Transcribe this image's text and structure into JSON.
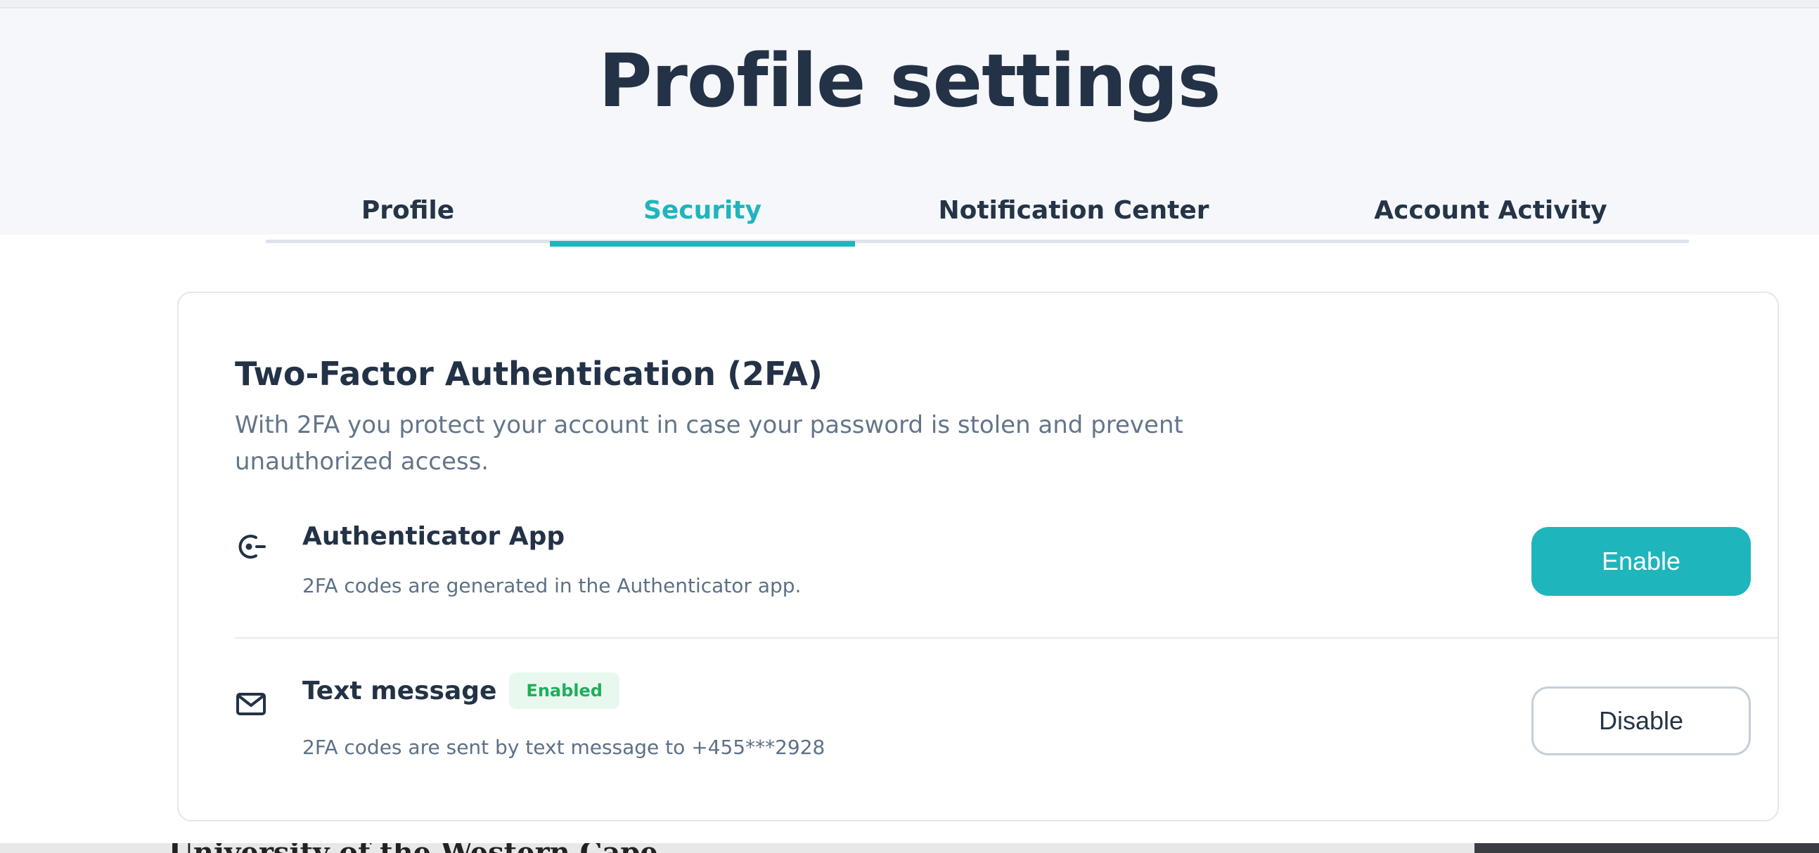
{
  "page": {
    "title": "Profile settings"
  },
  "tabs": [
    {
      "label": "Profile"
    },
    {
      "label": "Security"
    },
    {
      "label": "Notification Center"
    },
    {
      "label": "Account Activity"
    }
  ],
  "active_tab": "Security",
  "two_factor": {
    "title": "Two-Factor Authentication (2FA)",
    "description": "With 2FA you protect your account in case your password is stolen and prevent unauthorized access.",
    "methods": [
      {
        "name": "Authenticator App",
        "description": "2FA codes are generated in the Authenticator app.",
        "icon": "authenticator-icon",
        "button_label": "Enable"
      },
      {
        "name": "Text message",
        "badge": "Enabled",
        "description": "2FA codes are sent by text message to +455***2928",
        "icon": "mail-icon",
        "button_label": "Disable"
      }
    ]
  },
  "footer": {
    "partial_text": "University of the Western Cape"
  },
  "colors": {
    "accent": "#1fb5bd",
    "heading": "#233246",
    "muted": "#637589",
    "badge_bg": "#e8f8ef",
    "badge_text": "#1fae5b"
  }
}
